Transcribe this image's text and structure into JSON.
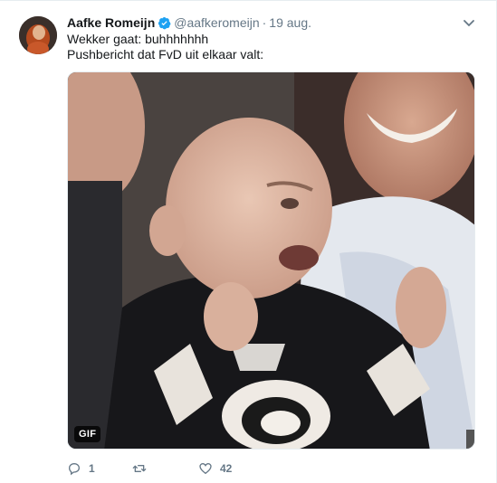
{
  "tweet": {
    "display_name": "Aafke Romeijn",
    "handle": "@aafkeromeijn",
    "separator": "·",
    "date": "19 aug.",
    "lines": [
      "Wekker gaat: buhhhhhhh",
      "Pushbericht dat FvD uit elkaar valt:"
    ],
    "media_badge": "GIF",
    "icons": {
      "verified": "verified-badge-icon",
      "menu": "chevron-down-icon",
      "reply": "reply-icon",
      "retweet": "retweet-icon",
      "like": "heart-icon"
    },
    "actions": {
      "reply_count": "1",
      "retweet_count": "",
      "like_count": "42"
    },
    "colors": {
      "verified": "#1da1f2",
      "secondary_text": "#657786",
      "text": "#14171a"
    }
  }
}
